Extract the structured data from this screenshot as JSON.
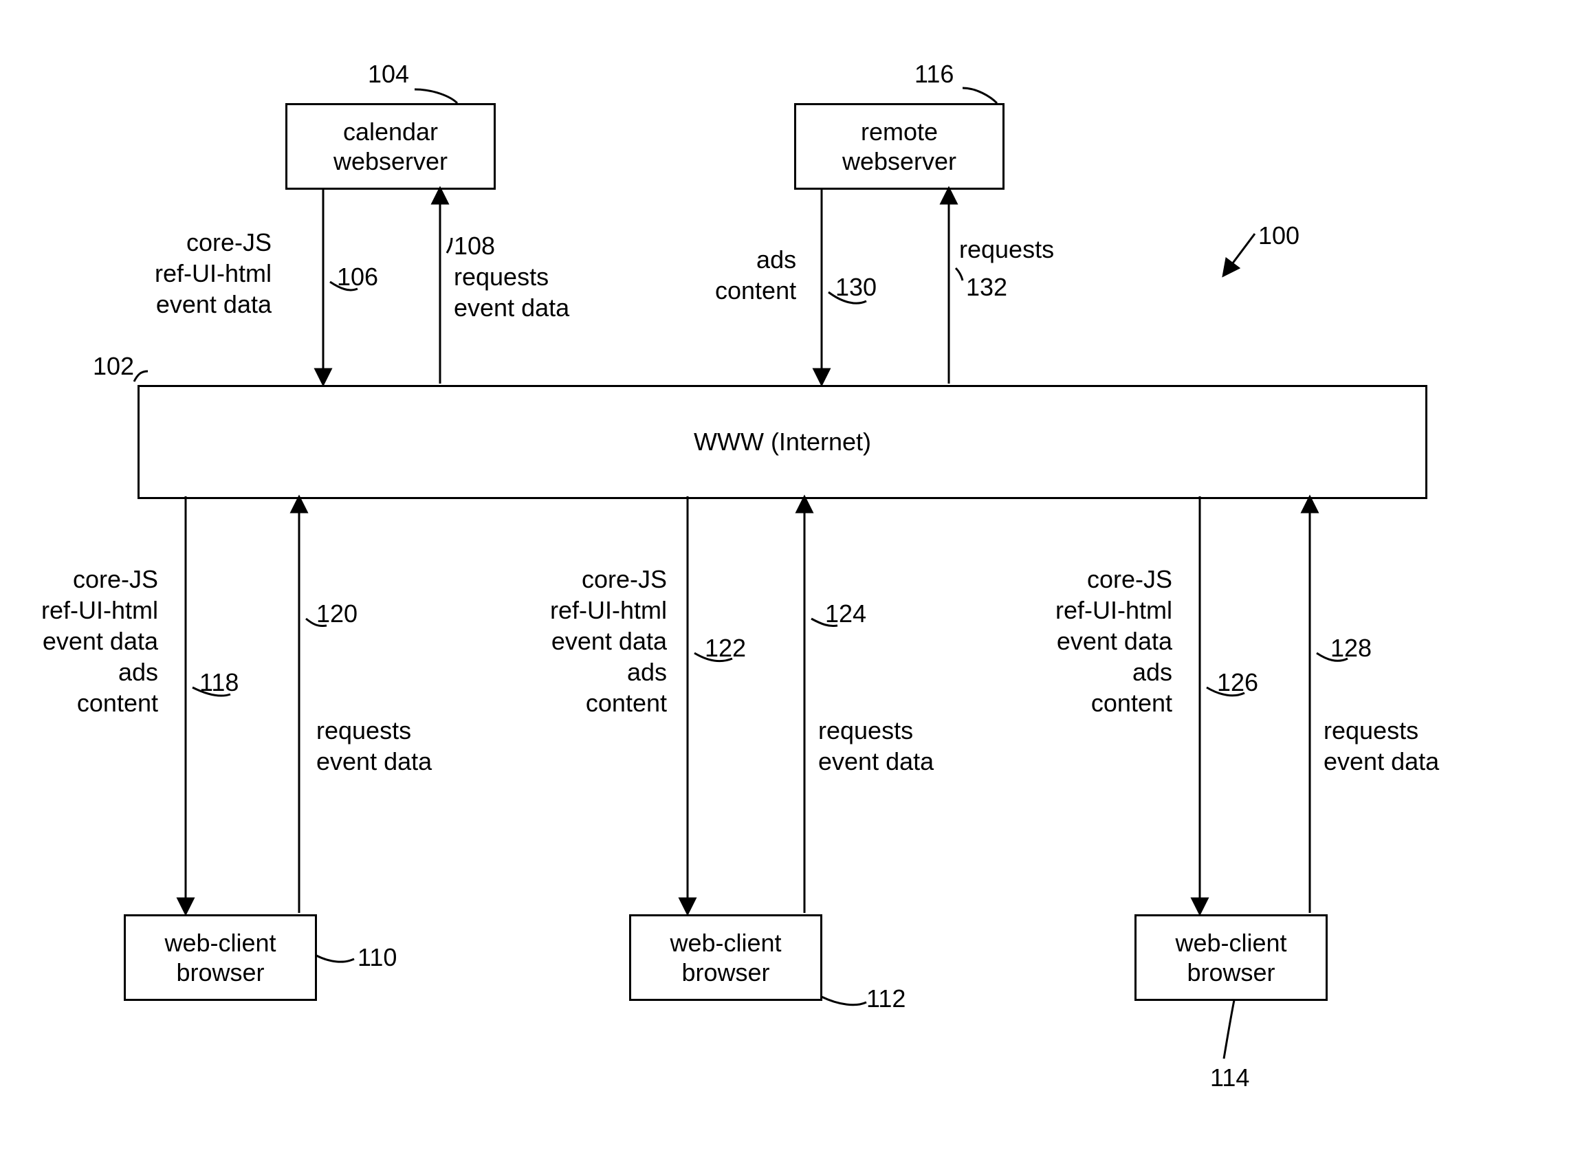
{
  "refs": {
    "r100": "100",
    "r102": "102",
    "r104": "104",
    "r106": "106",
    "r108": "108",
    "r110": "110",
    "r112": "112",
    "r114": "114",
    "r116": "116",
    "r118": "118",
    "r120": "120",
    "r122": "122",
    "r124": "124",
    "r126": "126",
    "r128": "128",
    "r130": "130",
    "r132": "132"
  },
  "boxes": {
    "calendar": "calendar\nwebserver",
    "remote": "remote\nwebserver",
    "www": "WWW (Internet)",
    "client1": "web-client\nbrowser",
    "client2": "web-client\nbrowser",
    "client3": "web-client\nbrowser"
  },
  "labels": {
    "cal_down": "core-JS\nref-UI-html\nevent data",
    "cal_up": "requests\nevent data",
    "remote_down": "ads\ncontent",
    "remote_up": "requests",
    "c1_down": "core-JS\nref-UI-html\nevent data\nads\ncontent",
    "c1_up": "requests\nevent data",
    "c2_down": "core-JS\nref-UI-html\nevent data\nads\ncontent",
    "c2_up": "requests\nevent data",
    "c3_down": "core-JS\nref-UI-html\nevent data\nads\ncontent",
    "c3_up": "requests\nevent data"
  }
}
